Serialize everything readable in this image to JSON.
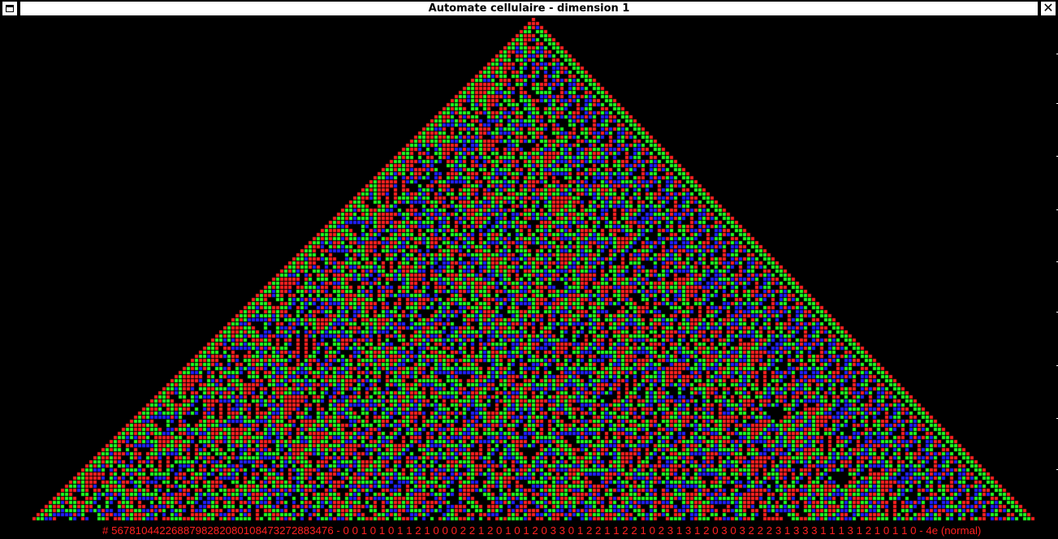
{
  "window": {
    "title": "Automate cellulaire - dimension 1",
    "menu_icon": "window-menu-icon",
    "close_icon": "close-icon"
  },
  "status": {
    "text": "# 56781044226887982820801084732728834​76 -  0 0 1 0 1 0 1 1 2 1 0 0 0 2 2 1 2 0 1 0 1 2 0 3 3 0 1 2 2 1 1 2 2 1 0 2 3 1 3 1 2 0 3 0 3 2 2 2 3 1 3 3 3 1 1 1 3 1 2 1 0 1 1 0 - 4e (normal)"
  },
  "automaton": {
    "colors": {
      "background": "#000000",
      "state1": "#ff2020",
      "state2": "#20ff20",
      "state3": "#2020ff"
    },
    "states": 4,
    "seed": "single-cell"
  }
}
